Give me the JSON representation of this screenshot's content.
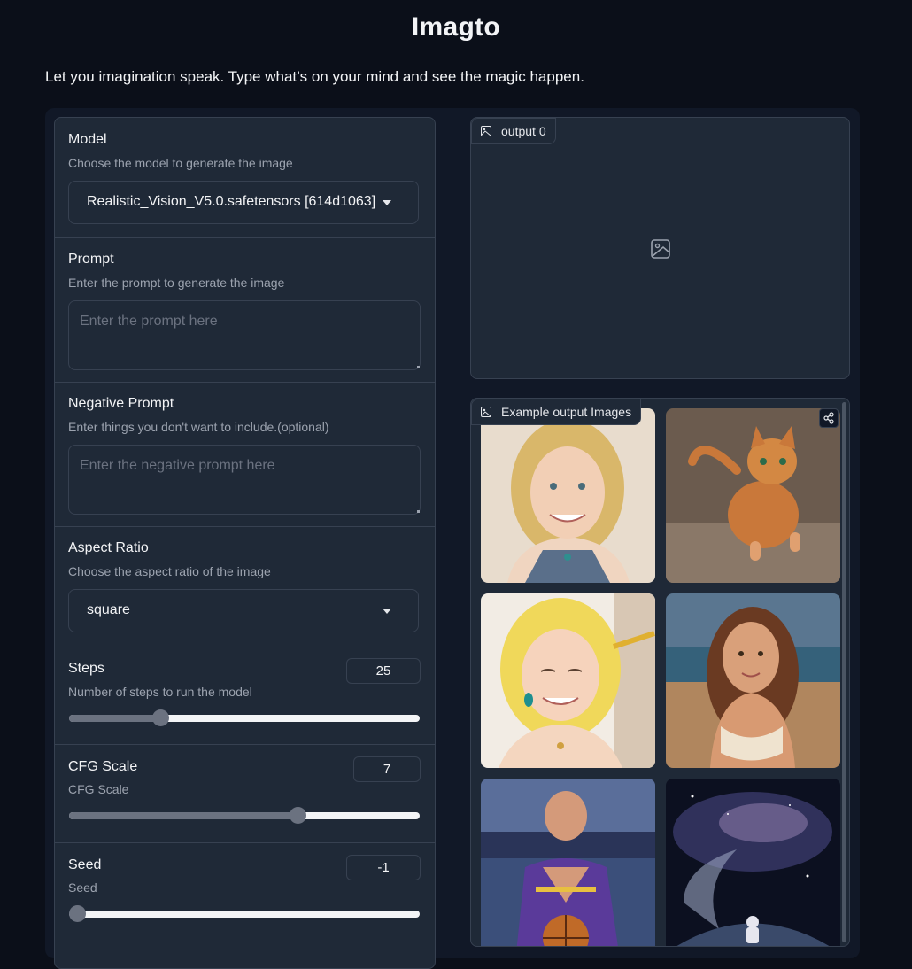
{
  "header": {
    "title": "Imagto",
    "subtitle": "Let you imagination speak. Type what’s on your mind and see the magic happen."
  },
  "model": {
    "label": "Model",
    "info": "Choose the model to generate the image",
    "selected": "Realistic_Vision_V5.0.safetensors [614d1063]"
  },
  "prompt": {
    "label": "Prompt",
    "info": "Enter the prompt to generate the image",
    "placeholder": "Enter the prompt here"
  },
  "negative_prompt": {
    "label": "Negative Prompt",
    "info": "Enter things you don't want to include.(optional)",
    "placeholder": "Enter the negative prompt here"
  },
  "aspect_ratio": {
    "label": "Aspect Ratio",
    "info": "Choose the aspect ratio of the image",
    "selected": "square"
  },
  "steps": {
    "label": "Steps",
    "info": "Number of steps to run the model",
    "value": "25",
    "fill_fraction": 0.25
  },
  "cfg_scale": {
    "label": "CFG Scale",
    "info": "CFG Scale",
    "value": "7",
    "fill_fraction": 0.66
  },
  "seed": {
    "label": "Seed",
    "info": "Seed",
    "value": "-1",
    "fill_fraction": 0.0
  },
  "output": {
    "label": "output 0"
  },
  "gallery": {
    "label": "Example output Images",
    "images": [
      {
        "icon": "portrait-drawing-blonde-woman"
      },
      {
        "icon": "orange-cat-walking"
      },
      {
        "icon": "drawing-of-blonde-woman-with-pencil"
      },
      {
        "icon": "woman-on-beach"
      },
      {
        "icon": "bald-basketball-player"
      },
      {
        "icon": "astronaut-in-space"
      }
    ]
  },
  "colors": {
    "background": "#0b0f19",
    "panel": "#1f2937",
    "border": "#374151",
    "slider_fill": "#6b7280"
  }
}
